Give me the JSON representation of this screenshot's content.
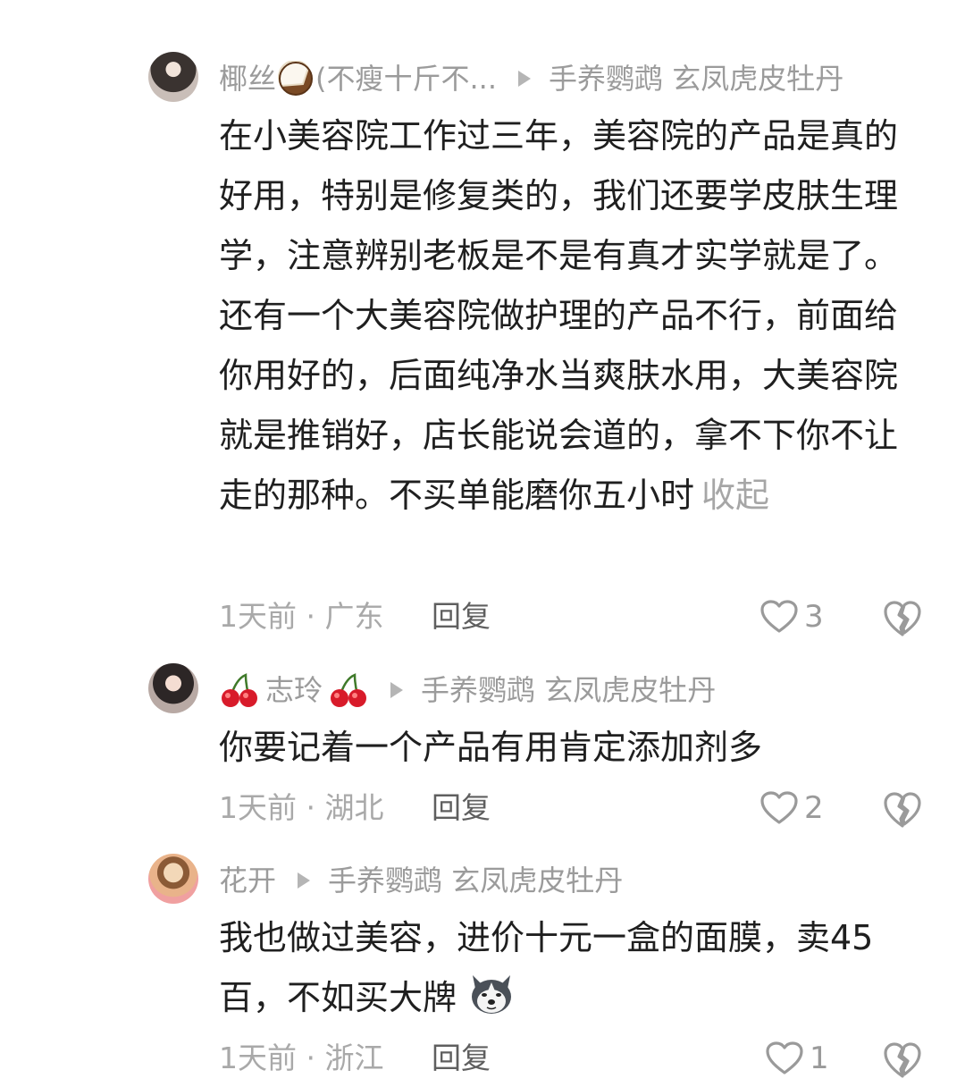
{
  "comments": [
    {
      "username": "椰丝",
      "username_suffix": "(不瘦十斤不...",
      "reply_target": "手养鹦鹉 玄凤虎皮牡丹",
      "text": "在小美容院工作过三年，美容院的产品是真的好用，特别是修复类的，我们还要学皮肤生理学，注意辨别老板是不是有真才实学就是了。还有一个大美容院做护理的产品不行，前面给你用好的，后面纯净水当爽肤水用，大美容院就是推销好，店长能说会道的，拿不下你不让走的那种。不买单能磨你五小时",
      "collapse_label": "收起",
      "meta": "1天前 · 广东",
      "reply_label": "回复",
      "likes": "3",
      "username_emoji": "coconut-icon"
    },
    {
      "username": "志玲",
      "reply_target": "手养鹦鹉 玄凤虎皮牡丹",
      "text": "你要记着一个产品有用肯定添加剂多",
      "meta": "1天前 · 湖北",
      "reply_label": "回复",
      "likes": "2",
      "username_emoji": "cherry-icon"
    },
    {
      "username": "花开",
      "reply_target": "手养鹦鹉 玄凤虎皮牡丹",
      "text": "我也做过美容，进价十元一盒的面膜，卖45百，不如买大牌",
      "meta": "1天前 · 浙江",
      "reply_label": "回复",
      "likes": "1",
      "text_emoji": "husky-dog-icon"
    }
  ],
  "colors": {
    "text": "#1f1f1f",
    "secondary": "#9b9b9b",
    "icon": "#9a9a9a"
  }
}
